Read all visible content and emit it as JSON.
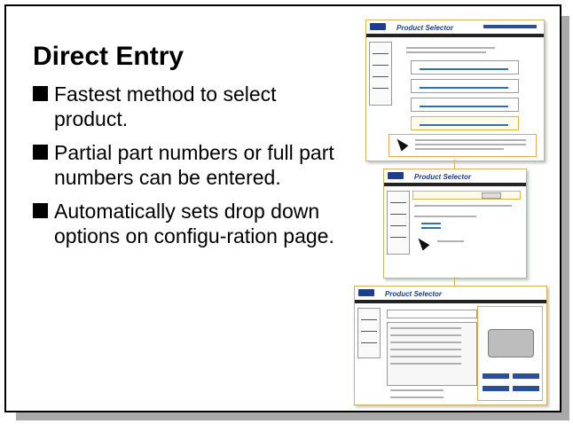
{
  "slide": {
    "title": "Direct Entry",
    "bullets": [
      "Fastest method to select product.",
      "Partial part numbers or full part numbers can be entered.",
      "Automatically sets drop down options on configu-ration page."
    ]
  },
  "thumbnails": [
    {
      "header_title": "Product Selector"
    },
    {
      "header_title": "Product Selector"
    },
    {
      "header_title": "Product Selector"
    }
  ],
  "colors": {
    "accent_blue": "#1d3e8a",
    "frame_gold": "#d9b15a",
    "shadow_gray": "#a9a9a9"
  }
}
